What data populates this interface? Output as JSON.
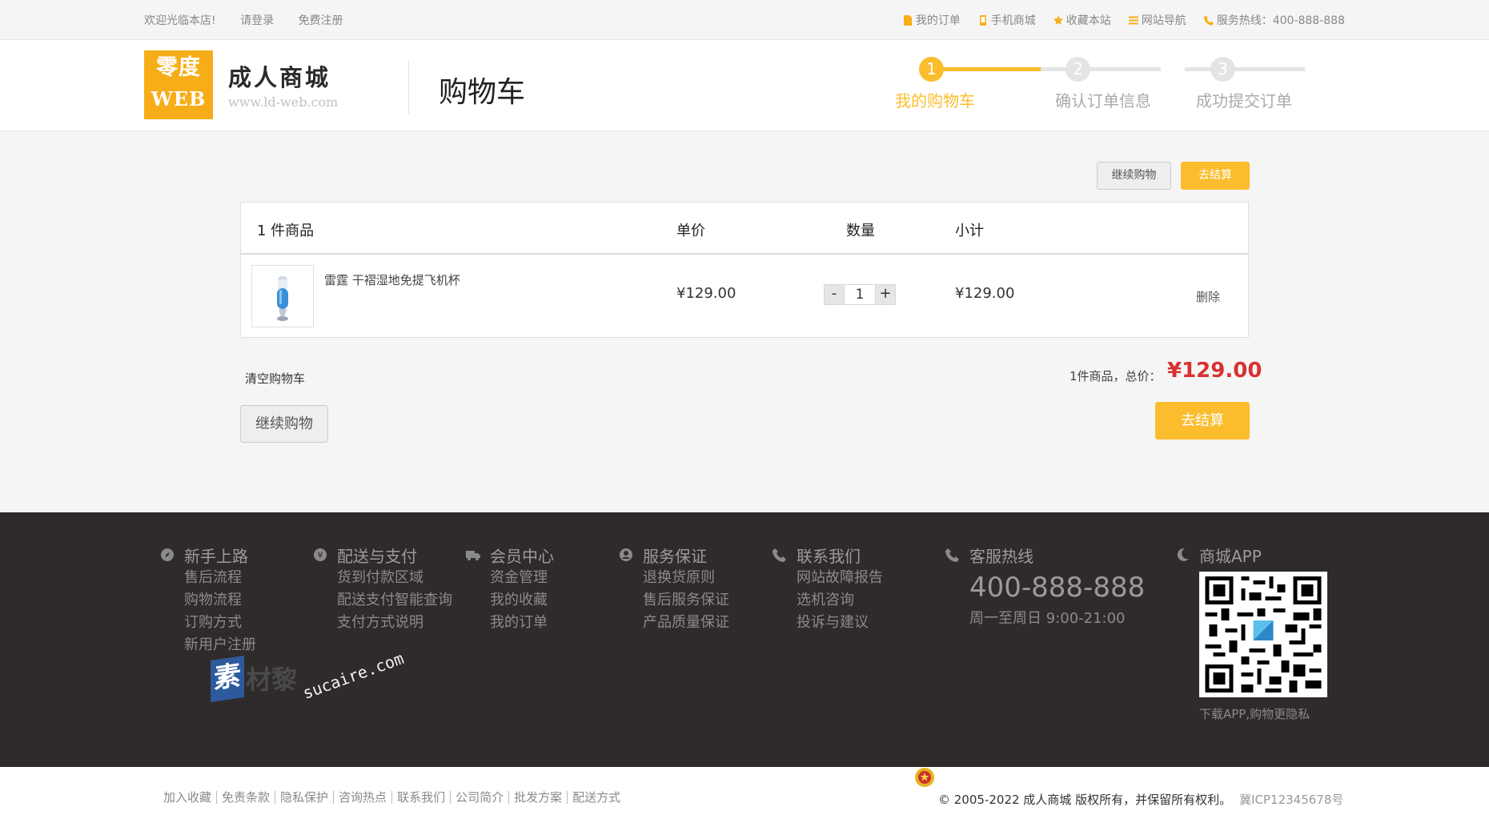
{
  "topbar": {
    "welcome": "欢迎光临本店!",
    "login": "请登录",
    "register": "免费注册",
    "links": [
      "我的订单",
      "手机商城",
      "收藏本站",
      "网站导航"
    ],
    "hotline": "服务热线：400-888-888"
  },
  "header": {
    "logo_line1": "零度",
    "logo_line2": "WEB",
    "brand_name": "成人商城",
    "brand_url": "www.ld-web.com",
    "page_title": "购物车"
  },
  "steps": [
    {
      "num": "1",
      "label": "我的购物车",
      "active": true
    },
    {
      "num": "2",
      "label": "确认订单信息",
      "active": false
    },
    {
      "num": "3",
      "label": "成功提交订单",
      "active": false
    }
  ],
  "actions": {
    "continue_shopping": "继续购物",
    "checkout": "去结算"
  },
  "cart": {
    "count_label": "1 件商品",
    "col_price": "单价",
    "col_qty": "数量",
    "col_subtotal": "小计",
    "items": [
      {
        "name": "雷霆 干褶湿地免提飞机杯",
        "price": "¥129.00",
        "qty": "1",
        "subtotal": "¥129.00",
        "delete": "删除"
      }
    ],
    "qty_minus": "-",
    "qty_plus": "+"
  },
  "summary": {
    "clear": "清空购物车",
    "total_label": "1件商品，总价：",
    "total_value": "¥129.00"
  },
  "footer": {
    "columns": [
      {
        "title": "新手上路",
        "items": [
          "售后流程",
          "购物流程",
          "订购方式",
          "新用户注册"
        ]
      },
      {
        "title": "配送与支付",
        "items": [
          "货到付款区域",
          "配送支付智能查询",
          "支付方式说明"
        ]
      },
      {
        "title": "会员中心",
        "items": [
          "资金管理",
          "我的收藏",
          "我的订单"
        ]
      },
      {
        "title": "服务保证",
        "items": [
          "退换货原则",
          "售后服务保证",
          "产品质量保证"
        ]
      },
      {
        "title": "联系我们",
        "items": [
          "网站故障报告",
          "选机咨询",
          "投诉与建议"
        ]
      }
    ],
    "service_title": "客服热线",
    "service_phone": "400-888-888",
    "service_hours": "周一至周日 9:00-21:00",
    "app_title": "商城APP",
    "app_tip": "下载APP,购物更隐私"
  },
  "watermark": {
    "text1": "素",
    "text2": "材黎",
    "url": "sucaire.com"
  },
  "bottom": {
    "links": [
      "加入收藏",
      "免责条款",
      "隐私保护",
      "咨询热点",
      "联系我们",
      "公司简介",
      "批发方案",
      "配送方式"
    ],
    "copyright": "© 2005-2022 成人商城 版权所有，并保留所有权利。",
    "icp": "冀ICP12345678号"
  },
  "colors": {
    "accent": "#fbbd2d",
    "price_red": "#d83131",
    "footer_bg": "#302b2b",
    "step_inactive": "#e4e4e4"
  }
}
